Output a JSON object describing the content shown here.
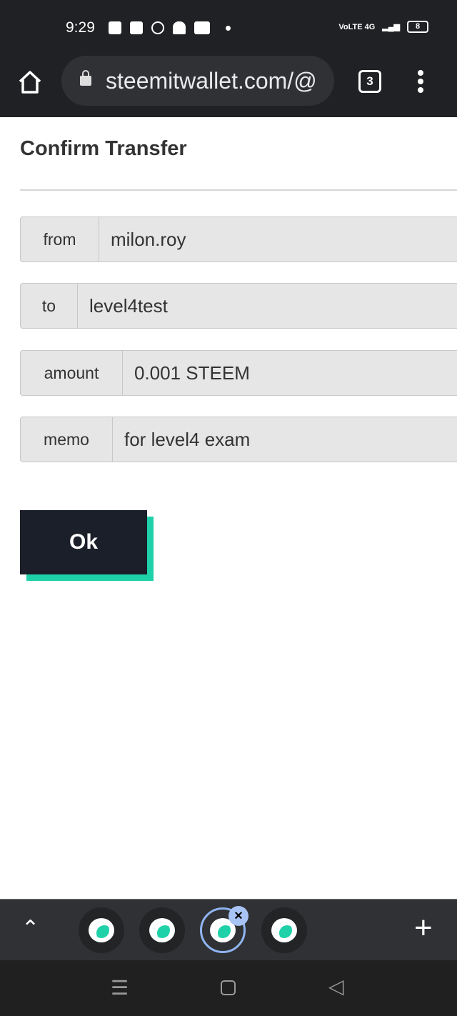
{
  "status_bar": {
    "time": "9:29",
    "network": "VoLTE 4G",
    "battery": "8"
  },
  "browser": {
    "url": "steemitwallet.com/@",
    "tab_count": "3"
  },
  "dialog": {
    "title": "Confirm Transfer",
    "fields": [
      {
        "label": "from",
        "value": "milon.roy"
      },
      {
        "label": "to",
        "value": "level4test"
      },
      {
        "label": "amount",
        "value": "0.001 STEEM"
      },
      {
        "label": "memo",
        "value": "for level4 exam"
      }
    ],
    "ok_label": "Ok"
  },
  "colors": {
    "accent": "#1fd1a8",
    "button": "#1a1f29"
  }
}
